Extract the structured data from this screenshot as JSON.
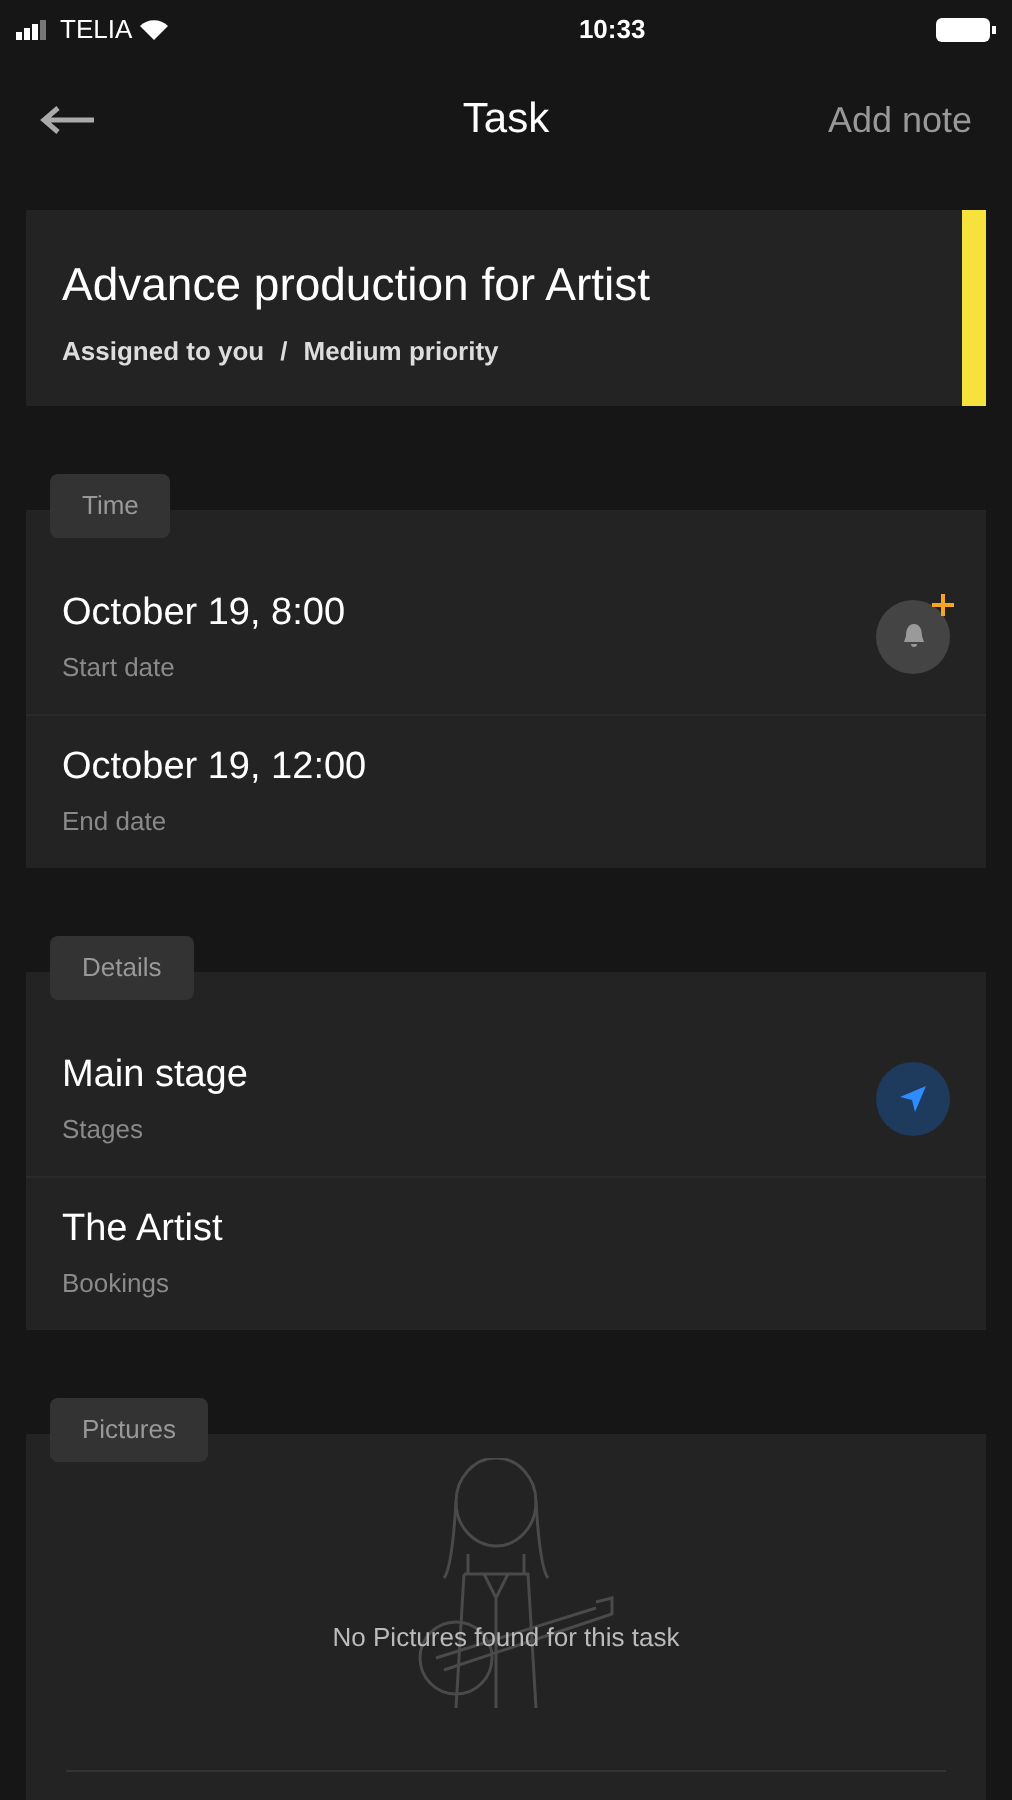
{
  "status_bar": {
    "carrier": "TELIA",
    "time": "10:33"
  },
  "header": {
    "title": "Task",
    "action": "Add note"
  },
  "task": {
    "title": "Advance production for Artist",
    "assignee": "Assigned to you",
    "separator": "/",
    "priority": "Medium priority"
  },
  "sections": [
    {
      "kind": "list",
      "label": "Time",
      "rows": [
        {
          "kind": "reminder",
          "title": "October 19, 8:00",
          "subtitle": "Start date"
        },
        {
          "kind": "plain",
          "title": "October 19, 12:00",
          "subtitle": "End date"
        }
      ]
    },
    {
      "kind": "list",
      "label": "Details",
      "rows": [
        {
          "kind": "navigate",
          "title": "Main stage",
          "subtitle": "Stages"
        },
        {
          "kind": "plain",
          "title": "The Artist",
          "subtitle": "Bookings"
        }
      ]
    },
    {
      "kind": "empty",
      "label": "Pictures",
      "message": "No Pictures found for this task"
    }
  ]
}
